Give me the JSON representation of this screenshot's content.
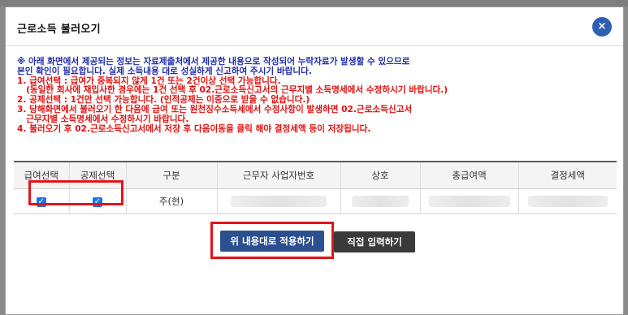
{
  "dialog": {
    "title": "근로소득 불러오기",
    "close_label": "×"
  },
  "notice": {
    "blue_lines": [
      "※ 아래 화면에서 제공되는 정보는 자료제출처에서 제공한 내용으로 작성되어 누락자료가 발생할 수 있으므로",
      "본인 확인이 필요합니다. 실제 소득내용 대로 성실하게 신고하여 주시기 바랍니다."
    ],
    "red_lines": [
      "1. 급여선택 : 급여가 중복되지 않게 1건 또는 2건이상 선택 가능합니다.",
      "   (동일한 회사에 재입사한 경우에는 1건 선택 후 02.근로소득신고서의 근무지별 소득명세에서 수정하시기 바랍니다.)",
      "2. 공제선택 : 1건만 선택 가능합니다. (인적공제는 이중으로 받을 수 없습니다.)",
      "3. 당해화면에서 불러오기 한 다음에 급여 또는 원천징수소득세에서 수정사항이 발생하면 02.근로소득신고서",
      "   근무지별 소득명세에서 수정하시기 바랍니다.",
      "4. 불러오기 후 02.근로소득신고서에서 저장 후 다음이동을 클릭 해야 결정세액 등이 저장됩니다."
    ]
  },
  "table": {
    "headers": [
      "급여선택",
      "공제선택",
      "구분",
      "근무자 사업자번호",
      "상호",
      "총급여액",
      "결정세액"
    ],
    "rows": [
      {
        "salary_checked": true,
        "deduction_checked": true,
        "type": "주(현)"
      }
    ]
  },
  "buttons": {
    "apply": "위 내용대로 적용하기",
    "direct": "직접 입력하기"
  },
  "colors": {
    "accent": "#2c4f8f",
    "highlight": "#e3131b",
    "notice_blue": "#1f2aa8",
    "notice_red": "#e01010"
  }
}
